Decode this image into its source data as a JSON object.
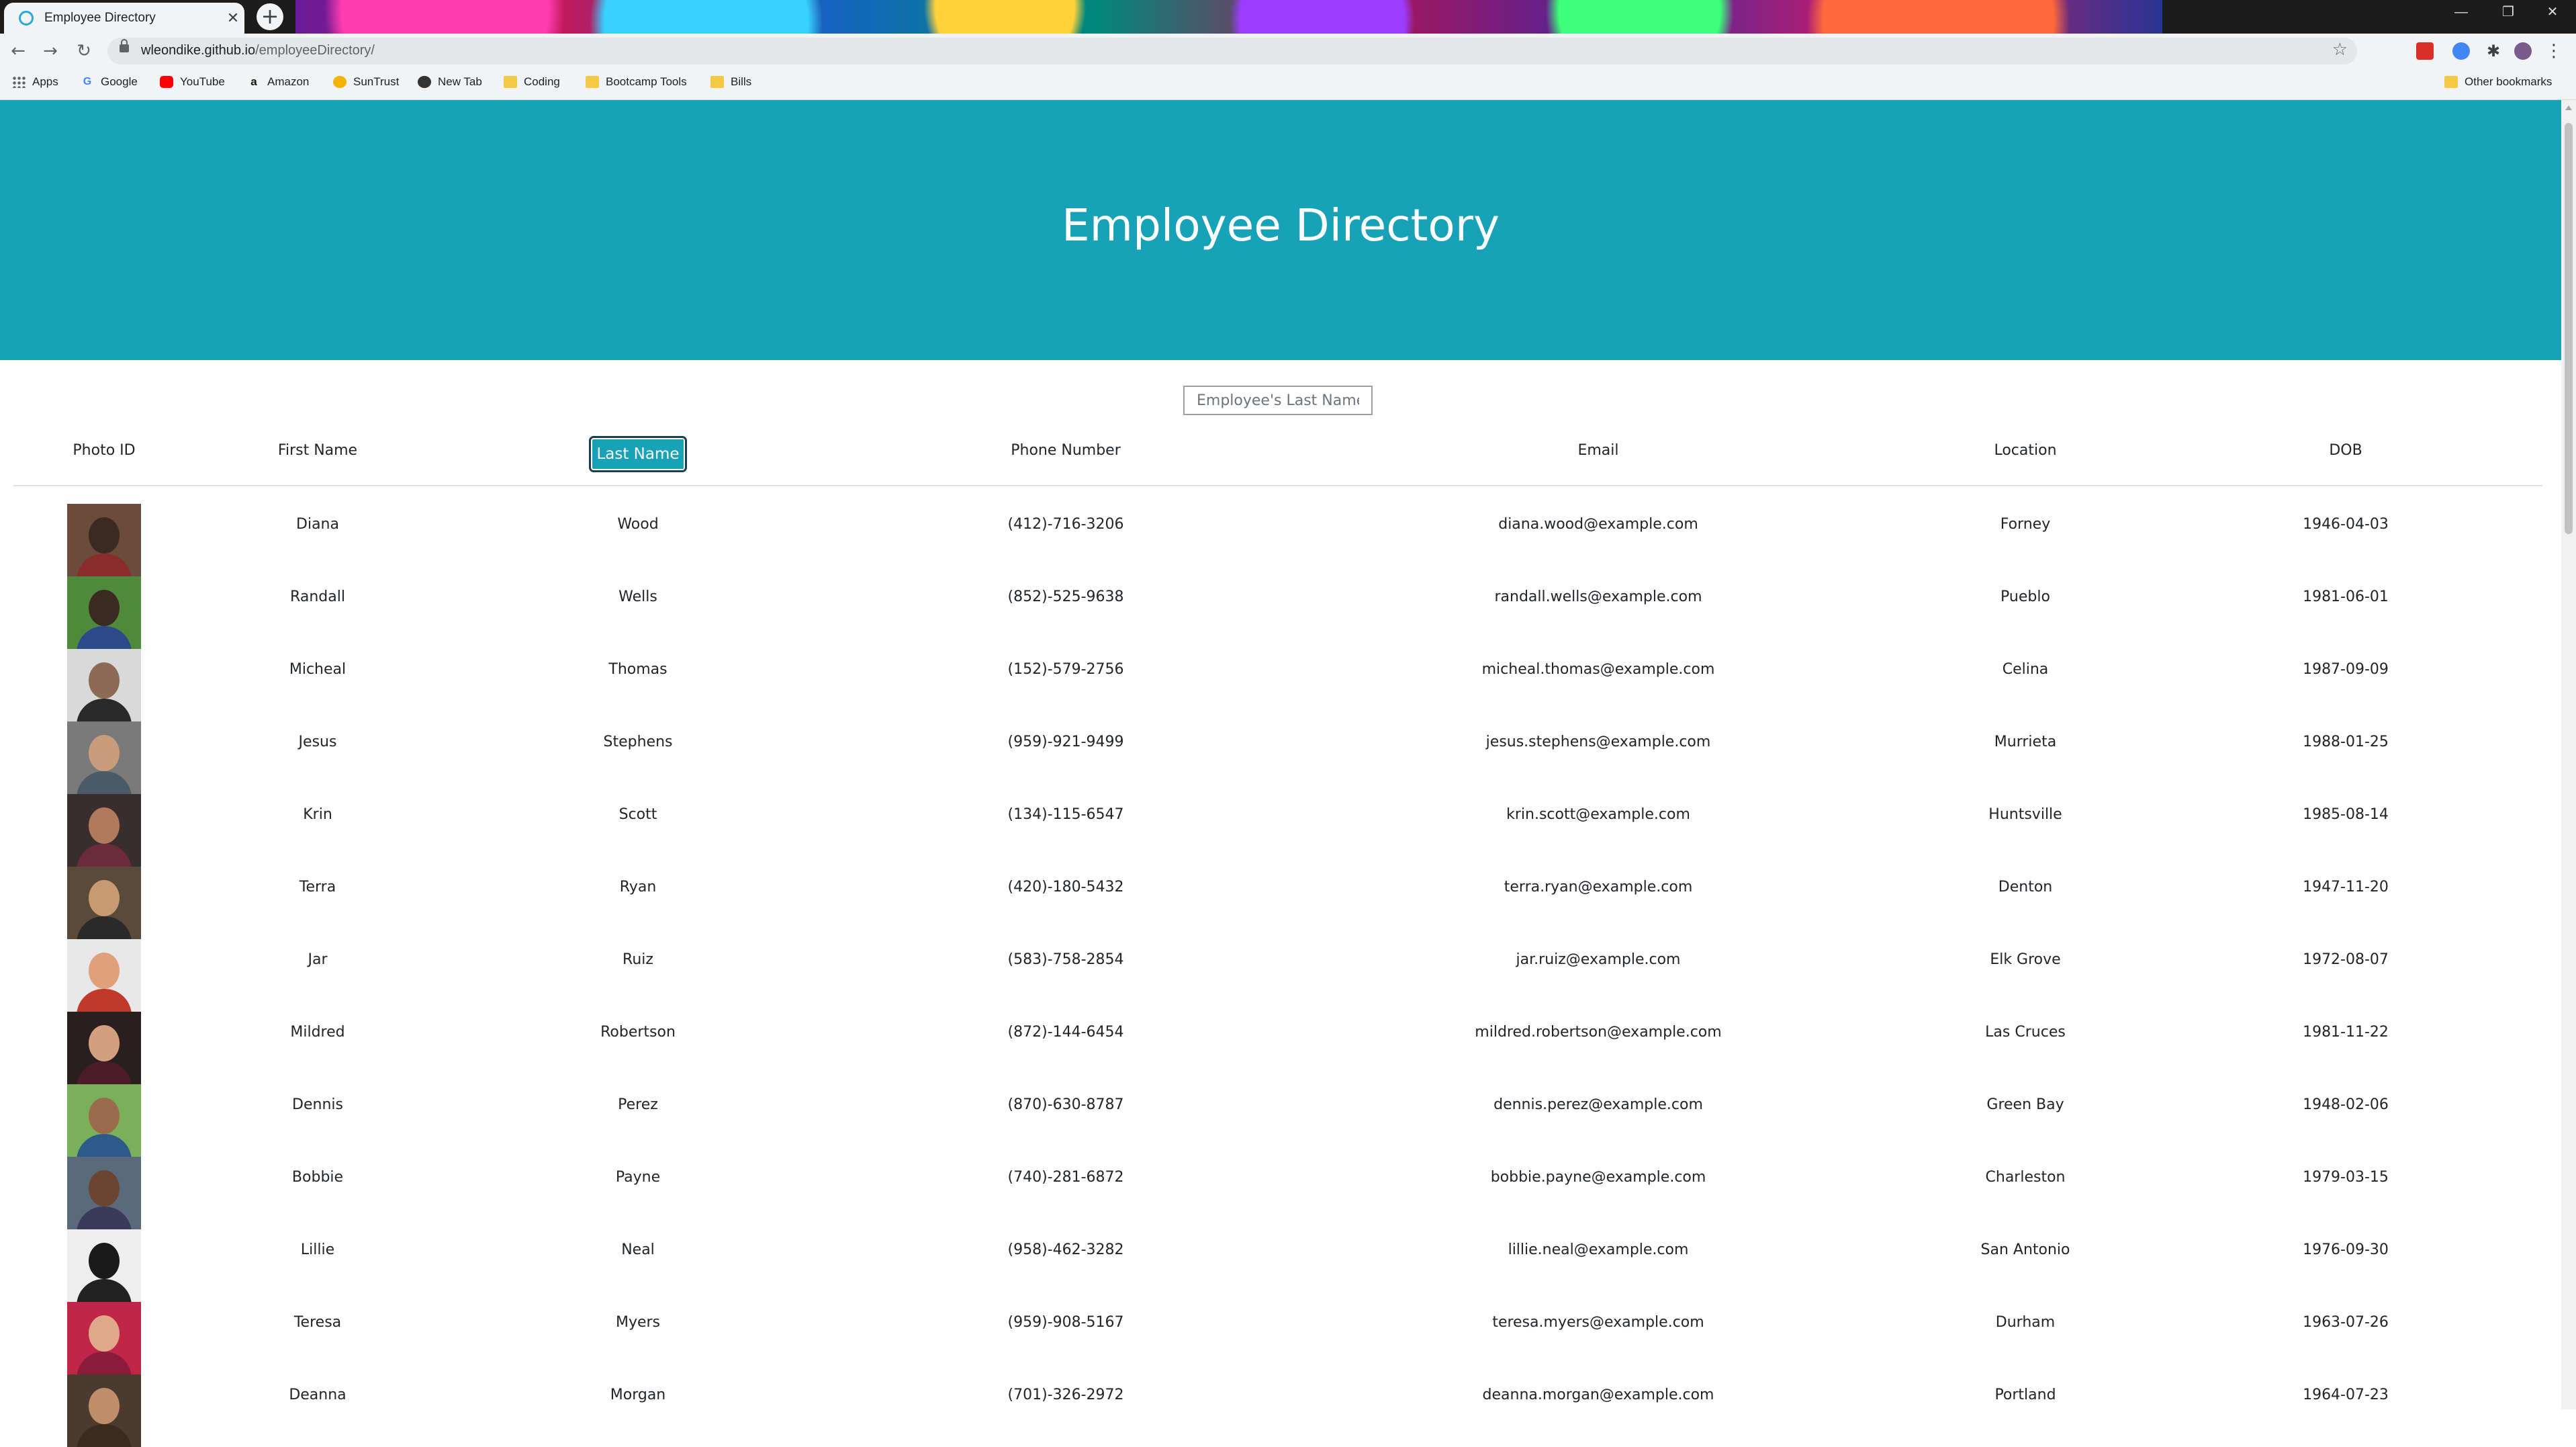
{
  "browser": {
    "tab_title": "Employee Directory",
    "tab_close": "✕",
    "new_tab": "+",
    "url_host": "wleondike.github.io",
    "url_path": "/employeeDirectory/",
    "window_controls": [
      "—",
      "❐",
      "✕"
    ],
    "bookmarks": [
      {
        "label": "Apps",
        "icon": "apps-icon"
      },
      {
        "label": "Google",
        "icon": "google-icon"
      },
      {
        "label": "YouTube",
        "icon": "youtube-icon"
      },
      {
        "label": "Amazon",
        "icon": "amazon-icon"
      },
      {
        "label": "SunTrust",
        "icon": "suntrust-icon"
      },
      {
        "label": "New Tab",
        "icon": "globe-icon"
      },
      {
        "label": "Coding",
        "icon": "folder-icon"
      },
      {
        "label": "Bootcamp Tools",
        "icon": "folder-icon"
      },
      {
        "label": "Bills",
        "icon": "folder-icon"
      }
    ],
    "other_bookmarks": "Other bookmarks"
  },
  "page": {
    "title": "Employee Directory",
    "search_placeholder": "Employee's Last Name",
    "columns": {
      "photo": "Photo ID",
      "first": "First Name",
      "last": "Last Name",
      "phone": "Phone Number",
      "email": "Email",
      "location": "Location",
      "dob": "DOB"
    }
  },
  "colors": {
    "accent": "#17a2b8",
    "header_text": "#ffffff"
  },
  "employees": [
    {
      "first": "Diana",
      "last": "Wood",
      "phone": "(412)-716-3206",
      "email": "diana.wood@example.com",
      "location": "Forney",
      "dob": "1946-04-03"
    },
    {
      "first": "Randall",
      "last": "Wells",
      "phone": "(852)-525-9638",
      "email": "randall.wells@example.com",
      "location": "Pueblo",
      "dob": "1981-06-01"
    },
    {
      "first": "Micheal",
      "last": "Thomas",
      "phone": "(152)-579-2756",
      "email": "micheal.thomas@example.com",
      "location": "Celina",
      "dob": "1987-09-09"
    },
    {
      "first": "Jesus",
      "last": "Stephens",
      "phone": "(959)-921-9499",
      "email": "jesus.stephens@example.com",
      "location": "Murrieta",
      "dob": "1988-01-25"
    },
    {
      "first": "Krin",
      "last": "Scott",
      "phone": "(134)-115-6547",
      "email": "krin.scott@example.com",
      "location": "Huntsville",
      "dob": "1985-08-14"
    },
    {
      "first": "Terra",
      "last": "Ryan",
      "phone": "(420)-180-5432",
      "email": "terra.ryan@example.com",
      "location": "Denton",
      "dob": "1947-11-20"
    },
    {
      "first": "Jar",
      "last": "Ruiz",
      "phone": "(583)-758-2854",
      "email": "jar.ruiz@example.com",
      "location": "Elk Grove",
      "dob": "1972-08-07"
    },
    {
      "first": "Mildred",
      "last": "Robertson",
      "phone": "(872)-144-6454",
      "email": "mildred.robertson@example.com",
      "location": "Las Cruces",
      "dob": "1981-11-22"
    },
    {
      "first": "Dennis",
      "last": "Perez",
      "phone": "(870)-630-8787",
      "email": "dennis.perez@example.com",
      "location": "Green Bay",
      "dob": "1948-02-06"
    },
    {
      "first": "Bobbie",
      "last": "Payne",
      "phone": "(740)-281-6872",
      "email": "bobbie.payne@example.com",
      "location": "Charleston",
      "dob": "1979-03-15"
    },
    {
      "first": "Lillie",
      "last": "Neal",
      "phone": "(958)-462-3282",
      "email": "lillie.neal@example.com",
      "location": "San Antonio",
      "dob": "1976-09-30"
    },
    {
      "first": "Teresa",
      "last": "Myers",
      "phone": "(959)-908-5167",
      "email": "teresa.myers@example.com",
      "location": "Durham",
      "dob": "1963-07-26"
    },
    {
      "first": "Deanna",
      "last": "Morgan",
      "phone": "(701)-326-2972",
      "email": "deanna.morgan@example.com",
      "location": "Portland",
      "dob": "1964-07-23"
    }
  ]
}
